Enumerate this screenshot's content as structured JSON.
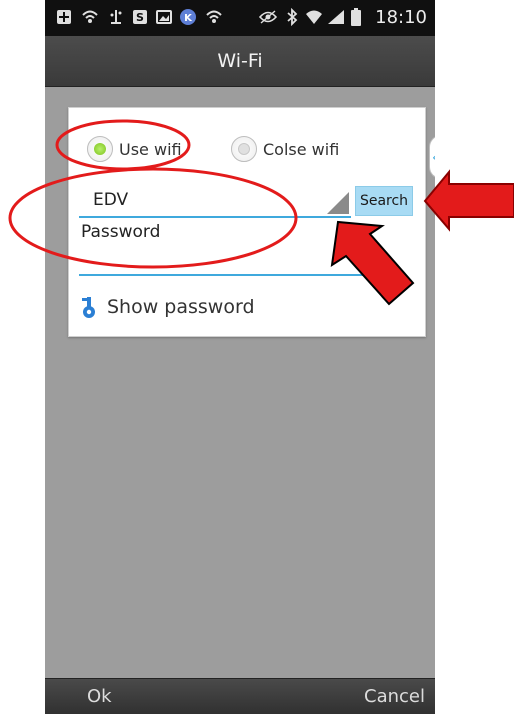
{
  "status_bar": {
    "time": "18:10",
    "icons": [
      "add-box-icon",
      "wifi-signal-icon",
      "usb-icon",
      "s-app-icon",
      "image-icon",
      "k-app-icon",
      "wifi-signal-icon",
      "eye-icon",
      "bluetooth-icon",
      "wifi-icon",
      "cell-signal-icon",
      "battery-icon"
    ]
  },
  "title_bar": {
    "title": "Wi-Fi"
  },
  "form": {
    "use_wifi_label": "Use wifi",
    "close_wifi_label": "Colse wifi",
    "use_wifi_selected": true,
    "ssid_value": "EDV",
    "search_label": "Search",
    "password_placeholder": "Password",
    "show_password_label": "Show password"
  },
  "side_tab": {
    "glyph": "‹"
  },
  "bottom_bar": {
    "ok_label": "Ok",
    "cancel_label": "Cancel"
  },
  "colors": {
    "accent": "#3fa9dd",
    "radio_on": "#7dc21e",
    "annotation": "#e31b1b",
    "background": "#9d9d9d"
  }
}
